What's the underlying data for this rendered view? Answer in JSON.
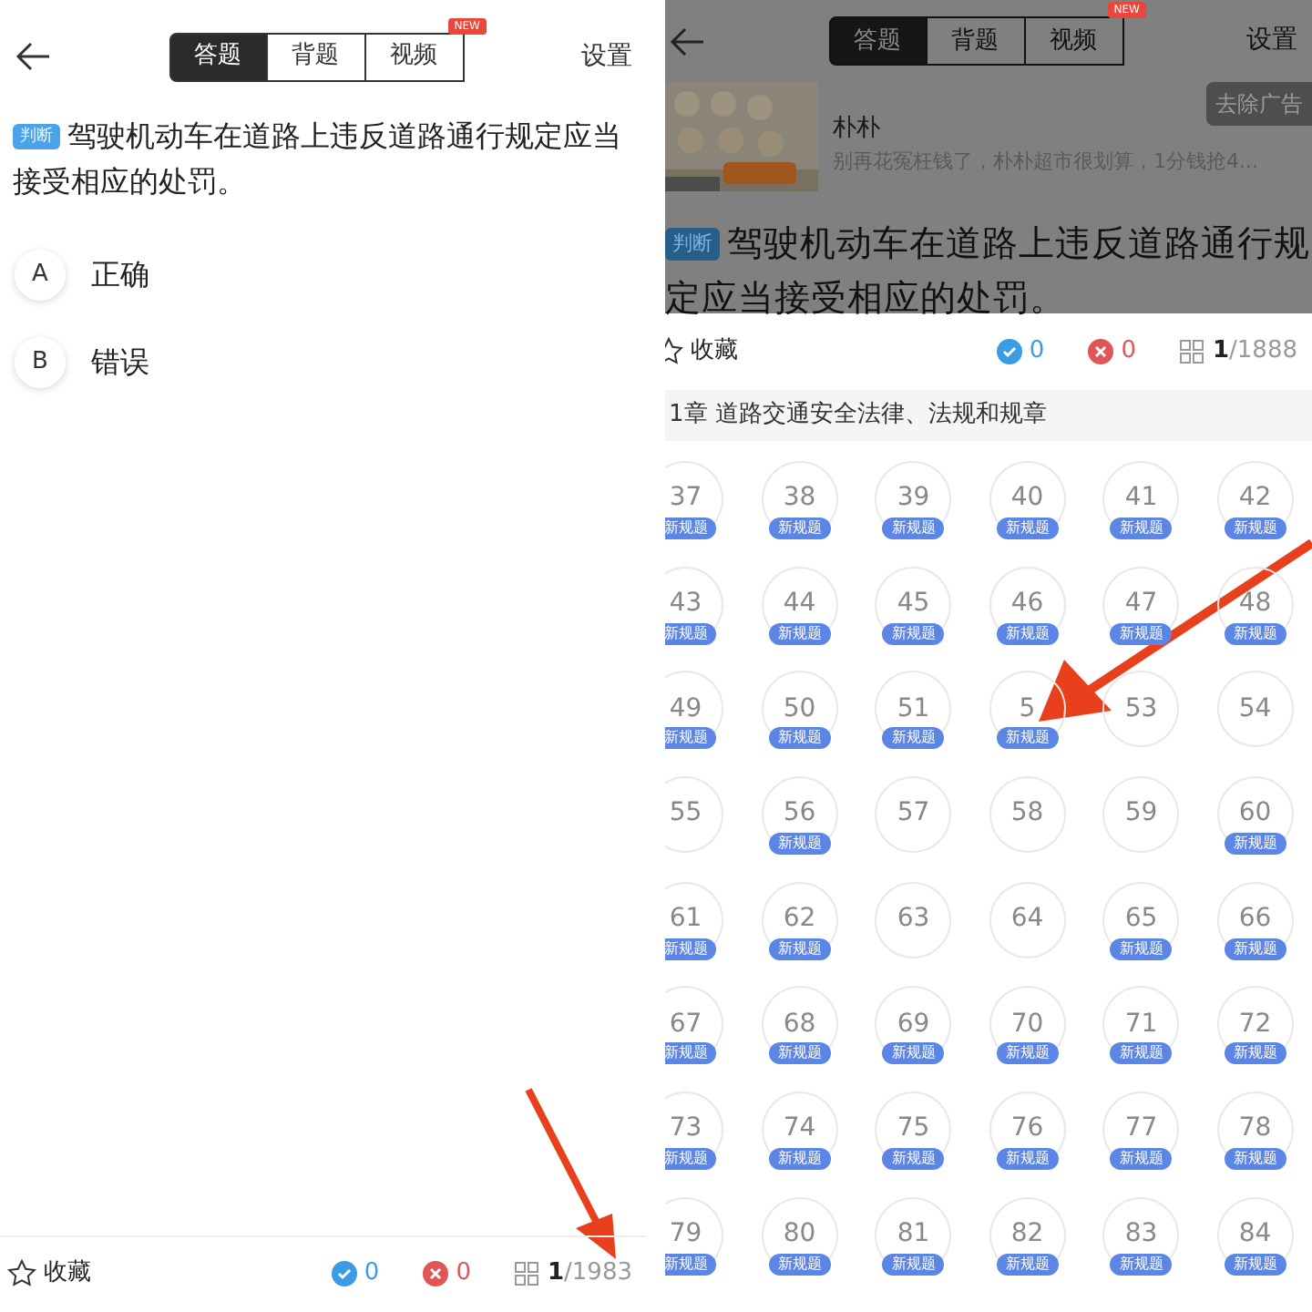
{
  "left_screen": {
    "header": {
      "tabs": [
        {
          "label": "答题",
          "selected": true
        },
        {
          "label": "背题",
          "selected": false
        },
        {
          "label": "视频",
          "selected": false
        }
      ],
      "new_badge": "NEW",
      "settings": "设置"
    },
    "question": {
      "type_tag": "判断",
      "text": "驾驶机动车在道路上违反道路通行规定应当接受相应的处罚。"
    },
    "options": [
      {
        "letter": "A",
        "text": "正确"
      },
      {
        "letter": "B",
        "text": "错误"
      }
    ],
    "bottom_bar": {
      "favorite": "收藏",
      "correct_count": "0",
      "wrong_count": "0",
      "current": "1",
      "total": "/1983"
    }
  },
  "right_screen": {
    "header": {
      "tabs": [
        {
          "label": "答题",
          "selected": true
        },
        {
          "label": "背题",
          "selected": false
        },
        {
          "label": "视频",
          "selected": false
        }
      ],
      "new_badge": "NEW",
      "settings": "设置"
    },
    "ad": {
      "kind": "picture",
      "title": "朴朴",
      "description": "别再花冤枉钱了，朴朴超市很划算，1分钱抢4...",
      "remove_button": "去除广告"
    },
    "question": {
      "type_tag": "判断",
      "text": "驾驶机动车在道路上违反道路通行规定应当接受相应的处罚。"
    },
    "bottom_bar": {
      "favorite": "收藏",
      "correct_count": "0",
      "wrong_count": "0",
      "current": "1",
      "total": "/1888"
    },
    "chapter": "1章 道路交通安全法律、法规和规章",
    "questions": [
      {
        "number": "37",
        "new_rule": true,
        "badge": "新规题"
      },
      {
        "number": "38",
        "new_rule": true,
        "badge": "新规题"
      },
      {
        "number": "39",
        "new_rule": true,
        "badge": "新规题"
      },
      {
        "number": "40",
        "new_rule": true,
        "badge": "新规题"
      },
      {
        "number": "41",
        "new_rule": true,
        "badge": "新规题"
      },
      {
        "number": "42",
        "new_rule": true,
        "badge": "新规题"
      },
      {
        "number": "43",
        "new_rule": true,
        "badge": "新规题"
      },
      {
        "number": "44",
        "new_rule": true,
        "badge": "新规题"
      },
      {
        "number": "45",
        "new_rule": true,
        "badge": "新规题"
      },
      {
        "number": "46",
        "new_rule": true,
        "badge": "新规题"
      },
      {
        "number": "47",
        "new_rule": true,
        "badge": "新规题"
      },
      {
        "number": "48",
        "new_rule": true,
        "badge": "新规题"
      },
      {
        "number": "49",
        "new_rule": true,
        "badge": "新规题"
      },
      {
        "number": "50",
        "new_rule": true,
        "badge": "新规题"
      },
      {
        "number": "51",
        "new_rule": true,
        "badge": "新规题"
      },
      {
        "number": "5",
        "new_rule": true,
        "badge": "新规题"
      },
      {
        "number": "53",
        "new_rule": false
      },
      {
        "number": "54",
        "new_rule": false
      },
      {
        "number": "55",
        "new_rule": false
      },
      {
        "number": "56",
        "new_rule": true,
        "badge": "新规题"
      },
      {
        "number": "57",
        "new_rule": false
      },
      {
        "number": "58",
        "new_rule": false
      },
      {
        "number": "59",
        "new_rule": false
      },
      {
        "number": "60",
        "new_rule": true,
        "badge": "新规题"
      },
      {
        "number": "61",
        "new_rule": true,
        "badge": "新规题"
      },
      {
        "number": "62",
        "new_rule": true,
        "badge": "新规题"
      },
      {
        "number": "63",
        "new_rule": false
      },
      {
        "number": "64",
        "new_rule": false
      },
      {
        "number": "65",
        "new_rule": true,
        "badge": "新规题"
      },
      {
        "number": "66",
        "new_rule": true,
        "badge": "新规题"
      },
      {
        "number": "67",
        "new_rule": true,
        "badge": "新规题"
      },
      {
        "number": "68",
        "new_rule": true,
        "badge": "新规题"
      },
      {
        "number": "69",
        "new_rule": true,
        "badge": "新规题"
      },
      {
        "number": "70",
        "new_rule": true,
        "badge": "新规题"
      },
      {
        "number": "71",
        "new_rule": true,
        "badge": "新规题"
      },
      {
        "number": "72",
        "new_rule": true,
        "badge": "新规题"
      },
      {
        "number": "73",
        "new_rule": true,
        "badge": "新规题"
      },
      {
        "number": "74",
        "new_rule": true,
        "badge": "新规题"
      },
      {
        "number": "75",
        "new_rule": true,
        "badge": "新规题"
      },
      {
        "number": "76",
        "new_rule": true,
        "badge": "新规题"
      },
      {
        "number": "77",
        "new_rule": true,
        "badge": "新规题"
      },
      {
        "number": "78",
        "new_rule": true,
        "badge": "新规题"
      },
      {
        "number": "79",
        "new_rule": true,
        "badge": "新规题"
      },
      {
        "number": "80",
        "new_rule": true,
        "badge": "新规题"
      },
      {
        "number": "81",
        "new_rule": true,
        "badge": "新规题"
      },
      {
        "number": "82",
        "new_rule": true,
        "badge": "新规题"
      },
      {
        "number": "83",
        "new_rule": true,
        "badge": "新规题"
      },
      {
        "number": "84",
        "new_rule": true,
        "badge": "新规题"
      }
    ]
  }
}
